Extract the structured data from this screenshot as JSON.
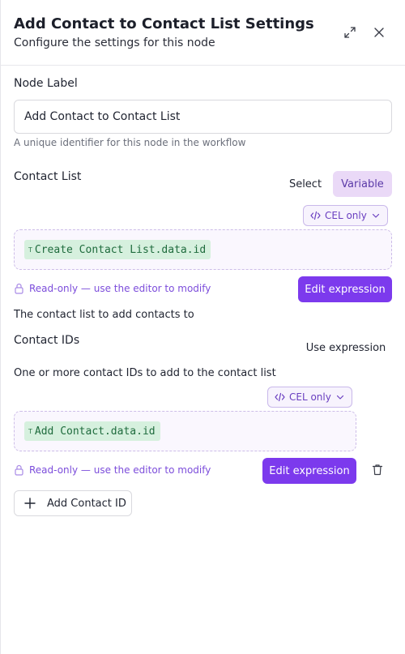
{
  "header": {
    "title": "Add Contact to Contact List Settings",
    "subtitle": "Configure the settings for this node"
  },
  "node_label": {
    "label": "Node Label",
    "value": "Add Contact to Contact List",
    "hint": "A unique identifier for this node in the workflow"
  },
  "contact_list": {
    "label": "Contact List",
    "mode_select": "Select",
    "mode_variable": "Variable",
    "active_mode": "Variable",
    "cel_badge": "CEL only",
    "chip_type": "T",
    "expression": "Create Contact List.data.id",
    "readonly_text": "Read-only — use the editor to modify",
    "edit_button": "Edit expression",
    "description": "The contact list to add contacts to"
  },
  "contact_ids": {
    "label": "Contact IDs",
    "use_expression": "Use expression",
    "description": "One or more contact IDs to add to the contact list",
    "items": [
      {
        "cel_badge": "CEL only",
        "chip_type": "T",
        "expression": "Add Contact.data.id",
        "readonly_text": "Read-only — use the editor to modify",
        "edit_button": "Edit expression"
      }
    ],
    "add_button": "Add Contact ID"
  },
  "icons": {
    "expand": "expand-icon",
    "close": "close-icon",
    "code": "code-icon",
    "chevron": "chevron-down-icon",
    "lock": "lock-icon",
    "trash": "trash-icon",
    "plus": "plus-icon"
  },
  "colors": {
    "accent": "#7c3aed",
    "accent_text": "#7c4ddb",
    "variable_bg": "#ead9f7",
    "chip_bg": "#d6f0de",
    "chip_text": "#1f6b3d"
  }
}
